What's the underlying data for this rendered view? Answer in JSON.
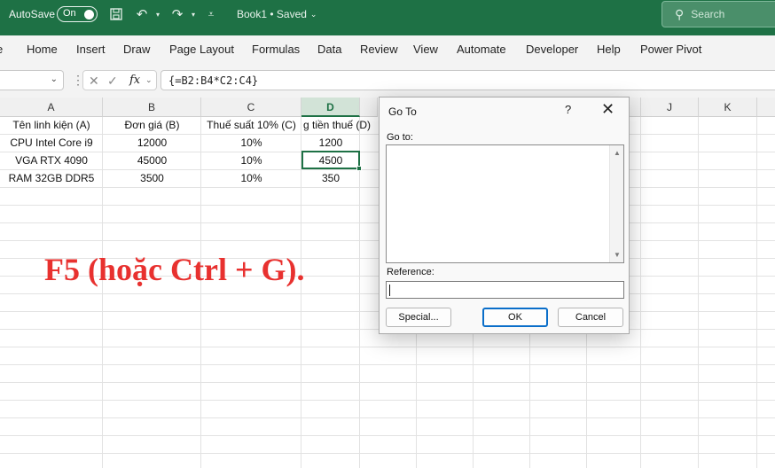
{
  "titlebar": {
    "autosave_label": "AutoSave",
    "autosave_state": "On",
    "title": "Book1 • Saved",
    "search_placeholder": "Search"
  },
  "ribbon": {
    "tabs": [
      "Home",
      "Insert",
      "Draw",
      "Page Layout",
      "Formulas",
      "Data",
      "Review",
      "View",
      "Automate",
      "Developer",
      "Help",
      "Power Pivot"
    ]
  },
  "formula_bar": {
    "fx_label": "fx",
    "formula": "{=B2:B4*C2:C4}"
  },
  "sheet": {
    "columns": [
      "A",
      "B",
      "C",
      "D",
      "E",
      "F",
      "G",
      "H",
      "I",
      "J",
      "K"
    ],
    "active_column": "D",
    "rows": [
      [
        "Tên linh kiện (A)",
        "Đơn giá (B)",
        "Thuế suất 10% (C)",
        "g tiền thuế (D)"
      ],
      [
        "CPU Intel Core i9",
        "12000",
        "10%",
        "1200"
      ],
      [
        "VGA RTX 4090",
        "45000",
        "10%",
        "4500"
      ],
      [
        "RAM 32GB DDR5",
        "3500",
        "10%",
        "350"
      ]
    ]
  },
  "overlay_text": "F5 (hoặc Ctrl + G).",
  "dialog": {
    "title": "Go To",
    "help": "?",
    "goto_label": "Go to:",
    "reference_label": "Reference:",
    "reference_value": "",
    "special_button": "Special...",
    "ok_button": "OK",
    "cancel_button": "Cancel"
  },
  "colors": {
    "brand": "#1e7145",
    "overlay": "#e8312f",
    "primary_button_border": "#0a6ec9"
  }
}
